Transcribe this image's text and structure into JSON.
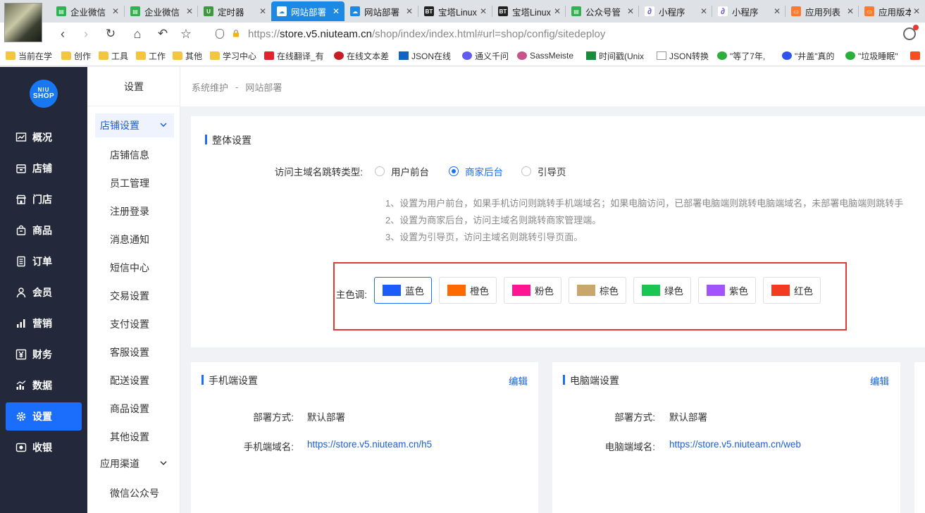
{
  "browser": {
    "tabs": [
      {
        "label": "企业微信",
        "color": "#2fb24f",
        "icon": "doc-icon"
      },
      {
        "label": "企业微信",
        "color": "#2fb24f",
        "icon": "doc-icon"
      },
      {
        "label": "定时器",
        "color": "#3c9a3c",
        "icon": "u-icon"
      },
      {
        "label": "网站部署",
        "color": "#1e88e5",
        "icon": "cloud-icon",
        "active": true
      },
      {
        "label": "网站部署",
        "color": "#1e88e5",
        "icon": "cloud-icon"
      },
      {
        "label": "宝塔Linux",
        "color": "#222222",
        "icon": "bt-icon"
      },
      {
        "label": "宝塔Linux",
        "color": "#222222",
        "icon": "bt-icon"
      },
      {
        "label": "公众号管",
        "color": "#2fb24f",
        "icon": "doc-icon"
      },
      {
        "label": "小程序",
        "color": "#6a5acd",
        "icon": "link-icon"
      },
      {
        "label": "小程序",
        "color": "#6a5acd",
        "icon": "link-icon"
      },
      {
        "label": "应用列表",
        "color": "#ff7a2f",
        "icon": "app-icon"
      },
      {
        "label": "应用版本",
        "color": "#ff7a2f",
        "icon": "app-icon"
      }
    ],
    "url": {
      "protocol": "https://",
      "host": "store.v5.niuteam.cn",
      "path": "/shop/index/index.html#url=shop/config/sitedeploy"
    },
    "bookmarks": [
      {
        "label": "当前在学",
        "type": "folder"
      },
      {
        "label": "创作",
        "type": "folder"
      },
      {
        "label": "工具",
        "type": "folder"
      },
      {
        "label": "工作",
        "type": "folder"
      },
      {
        "label": "其他",
        "type": "folder"
      },
      {
        "label": "学习中心",
        "type": "folder"
      },
      {
        "label": "在线翻译_有",
        "type": "site",
        "color": "#e0242b"
      },
      {
        "label": "在线文本差",
        "type": "site",
        "color": "#c81d25"
      },
      {
        "label": "JSON在线",
        "type": "site",
        "color": "#1565c0"
      },
      {
        "label": "通义千问",
        "type": "site",
        "color": "#615ced"
      },
      {
        "label": "SassMeiste",
        "type": "site",
        "color": "#c6538c"
      },
      {
        "label": "时间戳(Unix",
        "type": "site",
        "color": "#1b8a3a"
      },
      {
        "label": "JSON转换",
        "type": "site",
        "color": "#999999"
      },
      {
        "label": "\"等了7年,",
        "type": "site",
        "color": "#2bae3a"
      },
      {
        "label": "\"井盖\"真的",
        "type": "site",
        "color": "#2f54eb"
      },
      {
        "label": "\"垃圾睡眠\"",
        "type": "site",
        "color": "#2bae3a"
      }
    ]
  },
  "app": {
    "logo": {
      "line1": "NIU",
      "line2": "SHOP"
    },
    "menu": [
      {
        "label": "概况",
        "icon": "chart-icon"
      },
      {
        "label": "店铺",
        "icon": "store-icon"
      },
      {
        "label": "门店",
        "icon": "shop-icon"
      },
      {
        "label": "商品",
        "icon": "bag-icon"
      },
      {
        "label": "订单",
        "icon": "order-icon"
      },
      {
        "label": "会员",
        "icon": "user-icon"
      },
      {
        "label": "营销",
        "icon": "bar-icon"
      },
      {
        "label": "财务",
        "icon": "yen-icon"
      },
      {
        "label": "数据",
        "icon": "data-icon"
      },
      {
        "label": "设置",
        "icon": "gear-icon",
        "active": true
      },
      {
        "label": "收银",
        "icon": "cashier-icon"
      }
    ],
    "subnav": {
      "title": "设置",
      "group1": "店铺设置",
      "items": [
        "店铺信息",
        "员工管理",
        "注册登录",
        "消息通知",
        "短信中心",
        "交易设置",
        "支付设置",
        "客服设置",
        "配送设置",
        "商品设置",
        "其他设置"
      ],
      "group2": "应用渠道",
      "items2": [
        "微信公众号"
      ]
    },
    "breadcrumb": {
      "parent": "系统维护",
      "separator": "-",
      "current": "网站部署"
    },
    "overall": {
      "title": "整体设置",
      "redirect_label": "访问主域名跳转类型:",
      "options": [
        {
          "label": "用户前台",
          "checked": false
        },
        {
          "label": "商家后台",
          "checked": true
        },
        {
          "label": "引导页",
          "checked": false
        }
      ],
      "tips": [
        "1、设置为用户前台，如果手机访问则跳转手机端域名；如果电脑访问，已部署电脑端则跳转电脑端域名，未部署电脑端则跳转手",
        "2、设置为商家后台，访问主域名则跳转商家管理端。",
        "3、设置为引导页，访问主域名则跳转引导页面。"
      ],
      "color_label": "主色调:",
      "colors": [
        {
          "label": "蓝色",
          "hex": "#1b5cfb",
          "selected": true
        },
        {
          "label": "橙色",
          "hex": "#ff6a00"
        },
        {
          "label": "粉色",
          "hex": "#ff1493"
        },
        {
          "label": "棕色",
          "hex": "#c9a66b"
        },
        {
          "label": "绿色",
          "hex": "#19c654"
        },
        {
          "label": "紫色",
          "hex": "#a353fb"
        },
        {
          "label": "红色",
          "hex": "#f33b22"
        }
      ]
    },
    "mobile": {
      "title": "手机端设置",
      "edit": "编辑",
      "deploy_label": "部署方式:",
      "deploy_value": "默认部署",
      "domain_label": "手机端域名:",
      "domain_value": "https://store.v5.niuteam.cn/h5"
    },
    "pc": {
      "title": "电脑端设置",
      "edit": "编辑",
      "deploy_label": "部署方式:",
      "deploy_value": "默认部署",
      "domain_label": "电脑端域名:",
      "domain_value": "https://store.v5.niuteam.cn/web"
    }
  }
}
